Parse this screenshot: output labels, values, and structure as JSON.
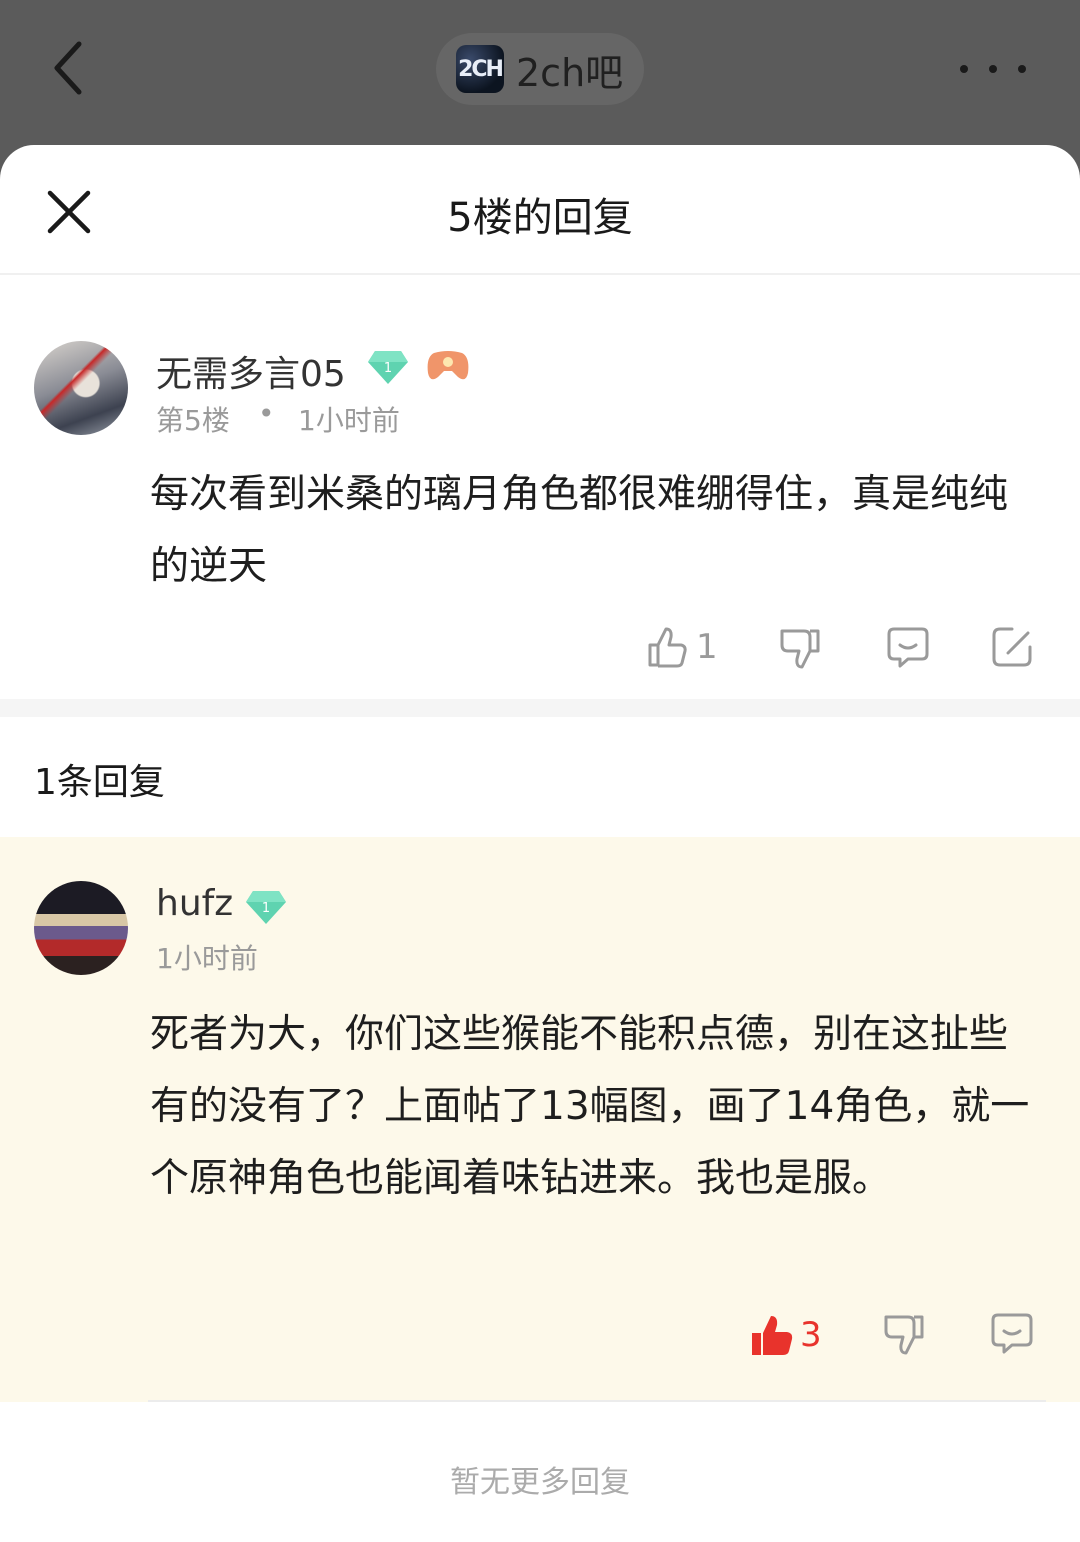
{
  "header": {
    "forum_logo_text": "2CH",
    "forum_name": "2ch吧",
    "back_icon": "chevron-left-icon",
    "more_icon": "more-dots-icon"
  },
  "sheet": {
    "title": "5楼的回复",
    "close_icon": "close-icon"
  },
  "post": {
    "username": "无需多言05",
    "level": "1",
    "floor": "第5楼",
    "separator": "•",
    "time": "1小时前",
    "content": "每次看到米桑的璃月角色都很难绷得住，真是纯纯的逆天",
    "like_count": "1",
    "actions": [
      "like-icon",
      "dislike-icon",
      "comment-icon",
      "edit-icon"
    ]
  },
  "replies": {
    "count_label": "1条回复",
    "items": [
      {
        "username": "hufz",
        "level": "1",
        "time": "1小时前",
        "content": "死者为大，你们这些猴能不能积点德，别在这扯些有的没有了？上面帖了13幅图，画了14角色，就一个原神角色也能闻着味钻进来。我也是服。",
        "like_count": "3",
        "liked": true
      }
    ],
    "footer": "暂无更多回复"
  },
  "colors": {
    "accent_red": "#e8332c",
    "badge_green": "#5fd3b0",
    "reply_bg": "#fdf9ea"
  }
}
